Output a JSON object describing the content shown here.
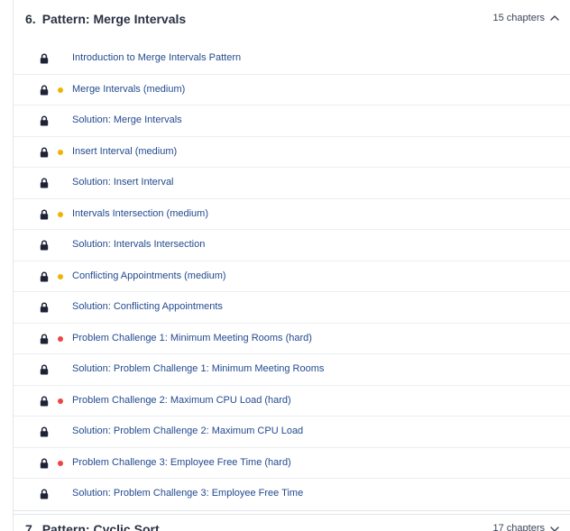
{
  "current_section": {
    "number": "6.",
    "title": "Pattern: Merge Intervals",
    "chapter_count": "15 chapters",
    "expanded_icon": "chevron-up-icon",
    "lessons": [
      {
        "title": "Introduction to Merge Intervals Pattern",
        "difficulty": "none",
        "locked": true
      },
      {
        "title": "Merge Intervals (medium)",
        "difficulty": "medium",
        "locked": true
      },
      {
        "title": "Solution: Merge Intervals",
        "difficulty": "none",
        "locked": true
      },
      {
        "title": "Insert Interval (medium)",
        "difficulty": "medium",
        "locked": true
      },
      {
        "title": "Solution: Insert Interval",
        "difficulty": "none",
        "locked": true
      },
      {
        "title": "Intervals Intersection (medium)",
        "difficulty": "medium",
        "locked": true
      },
      {
        "title": "Solution: Intervals Intersection",
        "difficulty": "none",
        "locked": true
      },
      {
        "title": "Conflicting Appointments (medium)",
        "difficulty": "medium",
        "locked": true
      },
      {
        "title": "Solution: Conflicting Appointments",
        "difficulty": "none",
        "locked": true
      },
      {
        "title": "Problem Challenge 1: Minimum Meeting Rooms (hard)",
        "difficulty": "hard",
        "locked": true
      },
      {
        "title": "Solution: Problem Challenge 1: Minimum Meeting Rooms",
        "difficulty": "none",
        "locked": true
      },
      {
        "title": "Problem Challenge 2: Maximum CPU Load (hard)",
        "difficulty": "hard",
        "locked": true
      },
      {
        "title": "Solution: Problem Challenge 2: Maximum CPU Load",
        "difficulty": "none",
        "locked": true
      },
      {
        "title": "Problem Challenge 3: Employee Free Time (hard)",
        "difficulty": "hard",
        "locked": true
      },
      {
        "title": "Solution: Problem Challenge 3: Employee Free Time",
        "difficulty": "none",
        "locked": true
      }
    ]
  },
  "next_section": {
    "number": "7.",
    "title": "Pattern: Cyclic Sort",
    "chapter_count": "17 chapters",
    "collapsed_icon": "chevron-down-icon"
  },
  "colors": {
    "medium_dot": "#f0b400",
    "hard_dot": "#ef4444",
    "lesson_link": "#234a8f",
    "lock_icon": "#1f2235"
  }
}
